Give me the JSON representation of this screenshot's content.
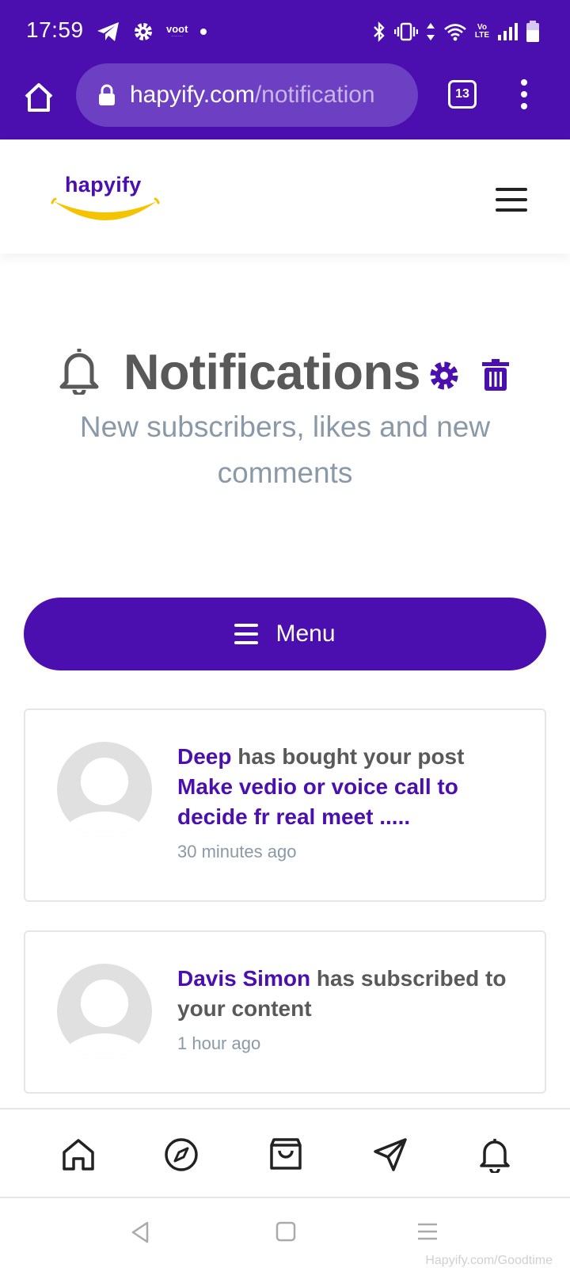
{
  "status_bar": {
    "time": "17:59",
    "voot_label": "voot",
    "network_label_top": "Vo",
    "network_label_bottom": "LTE"
  },
  "browser": {
    "url_host": "hapyify.com",
    "url_path": "/notification",
    "tab_count": "13"
  },
  "site": {
    "logo_text": "hapyify"
  },
  "page": {
    "title": "Notifications",
    "subtitle": "New subscribers, likes and new comments",
    "menu_label": "Menu"
  },
  "notifications": [
    {
      "actor": "Deep",
      "action": " has bought your post ",
      "target": "Make vedio or voice call to decide fr real meet .....",
      "time": "30 minutes ago"
    },
    {
      "actor": "Davis Simon",
      "action": " has subscribed to your content",
      "target": "",
      "time": "1 hour ago"
    }
  ],
  "bottom_nav": {
    "icons": [
      "home-icon",
      "compass-icon",
      "shopping-bag-icon",
      "send-icon",
      "bell-icon"
    ]
  },
  "watermark": "Hapyify.com/Goodtime",
  "colors": {
    "brand": "#4a0fae",
    "logo_smile": "#f5c400",
    "title_gray": "#595959",
    "muted": "#8a99a8"
  }
}
